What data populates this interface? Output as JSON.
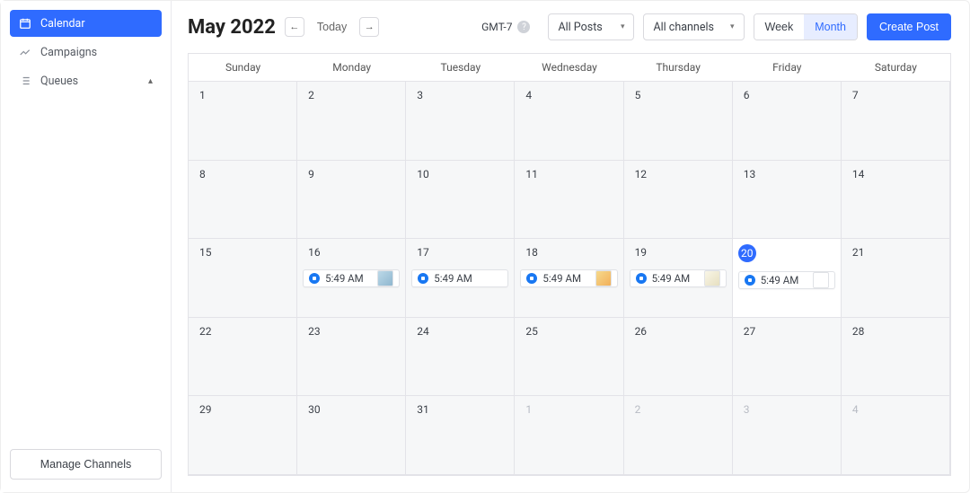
{
  "sidebar": {
    "items": [
      {
        "label": "Calendar"
      },
      {
        "label": "Campaigns"
      },
      {
        "label": "Queues"
      }
    ],
    "manage_label": "Manage Channels"
  },
  "header": {
    "title": "May 2022",
    "today_label": "Today",
    "timezone": "GMT-7",
    "filter_posts": "All Posts",
    "filter_channels": "All channels",
    "view_week": "Week",
    "view_month": "Month",
    "create_label": "Create Post"
  },
  "calendar": {
    "weekdays": [
      "Sunday",
      "Monday",
      "Tuesday",
      "Wednesday",
      "Thursday",
      "Friday",
      "Saturday"
    ],
    "today_index": 19,
    "cells": [
      {
        "n": "1",
        "cur": true
      },
      {
        "n": "2",
        "cur": true
      },
      {
        "n": "3",
        "cur": true
      },
      {
        "n": "4",
        "cur": true
      },
      {
        "n": "5",
        "cur": true
      },
      {
        "n": "6",
        "cur": true
      },
      {
        "n": "7",
        "cur": true
      },
      {
        "n": "8",
        "cur": true
      },
      {
        "n": "9",
        "cur": true
      },
      {
        "n": "10",
        "cur": true
      },
      {
        "n": "11",
        "cur": true
      },
      {
        "n": "12",
        "cur": true
      },
      {
        "n": "13",
        "cur": true
      },
      {
        "n": "14",
        "cur": true
      },
      {
        "n": "15",
        "cur": true
      },
      {
        "n": "16",
        "cur": true,
        "event": {
          "time": "5:49 AM",
          "thumb": "alt1"
        }
      },
      {
        "n": "17",
        "cur": true,
        "event": {
          "time": "5:49 AM",
          "thumb": "none"
        }
      },
      {
        "n": "18",
        "cur": true,
        "event": {
          "time": "5:49 AM",
          "thumb": ""
        }
      },
      {
        "n": "19",
        "cur": true,
        "event": {
          "time": "5:49 AM",
          "thumb": "alt2"
        }
      },
      {
        "n": "20",
        "cur": true,
        "bright": true,
        "event": {
          "time": "5:49 AM",
          "thumb": "alt3"
        }
      },
      {
        "n": "21",
        "cur": true
      },
      {
        "n": "22",
        "cur": true
      },
      {
        "n": "23",
        "cur": true
      },
      {
        "n": "24",
        "cur": true
      },
      {
        "n": "25",
        "cur": true
      },
      {
        "n": "26",
        "cur": true
      },
      {
        "n": "27",
        "cur": true
      },
      {
        "n": "28",
        "cur": true
      },
      {
        "n": "29",
        "cur": true
      },
      {
        "n": "30",
        "cur": true
      },
      {
        "n": "31",
        "cur": true
      },
      {
        "n": "1",
        "cur": false
      },
      {
        "n": "2",
        "cur": false
      },
      {
        "n": "3",
        "cur": false
      },
      {
        "n": "4",
        "cur": false
      }
    ]
  }
}
